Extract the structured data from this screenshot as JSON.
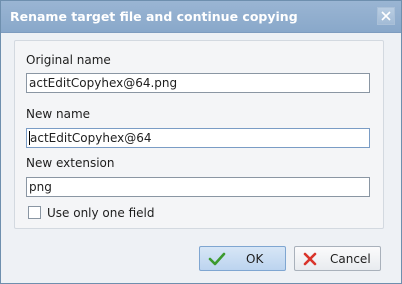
{
  "window": {
    "title": "Rename target file and continue copying"
  },
  "form": {
    "original_name_label": "Original name",
    "original_name_value": "actEditCopyhex@64.png",
    "new_name_label": "New name",
    "new_name_value": "actEditCopyhex@64",
    "new_extension_label": "New extension",
    "new_extension_value": "png",
    "use_one_field_label": "Use only one field",
    "use_one_field_checked": false
  },
  "buttons": {
    "ok_label": "OK",
    "cancel_label": "Cancel"
  },
  "icons": {
    "close": "close-icon",
    "ok": "checkmark-icon",
    "cancel": "cross-icon"
  },
  "colors": {
    "titlebar": "#89a8ca",
    "ok_check": "#3c9a2e",
    "cancel_cross": "#d9342b"
  }
}
